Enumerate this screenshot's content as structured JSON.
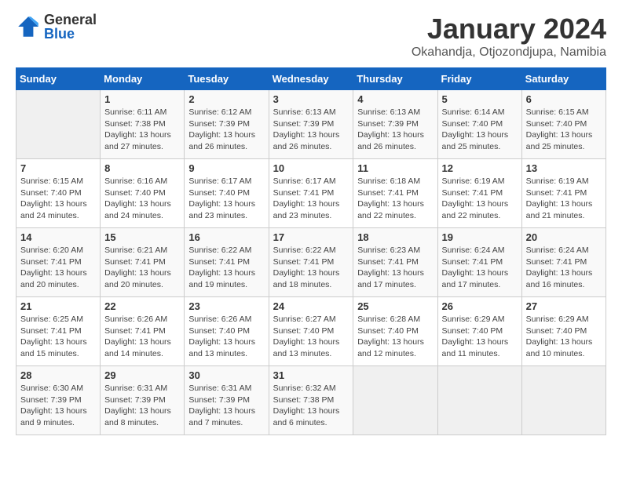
{
  "header": {
    "logo_general": "General",
    "logo_blue": "Blue",
    "month_title": "January 2024",
    "location": "Okahandja, Otjozondjupa, Namibia"
  },
  "days_of_week": [
    "Sunday",
    "Monday",
    "Tuesday",
    "Wednesday",
    "Thursday",
    "Friday",
    "Saturday"
  ],
  "weeks": [
    [
      {
        "day": "",
        "info": ""
      },
      {
        "day": "1",
        "info": "Sunrise: 6:11 AM\nSunset: 7:38 PM\nDaylight: 13 hours and 27 minutes."
      },
      {
        "day": "2",
        "info": "Sunrise: 6:12 AM\nSunset: 7:39 PM\nDaylight: 13 hours and 26 minutes."
      },
      {
        "day": "3",
        "info": "Sunrise: 6:13 AM\nSunset: 7:39 PM\nDaylight: 13 hours and 26 minutes."
      },
      {
        "day": "4",
        "info": "Sunrise: 6:13 AM\nSunset: 7:39 PM\nDaylight: 13 hours and 26 minutes."
      },
      {
        "day": "5",
        "info": "Sunrise: 6:14 AM\nSunset: 7:40 PM\nDaylight: 13 hours and 25 minutes."
      },
      {
        "day": "6",
        "info": "Sunrise: 6:15 AM\nSunset: 7:40 PM\nDaylight: 13 hours and 25 minutes."
      }
    ],
    [
      {
        "day": "7",
        "info": "Sunrise: 6:15 AM\nSunset: 7:40 PM\nDaylight: 13 hours and 24 minutes."
      },
      {
        "day": "8",
        "info": "Sunrise: 6:16 AM\nSunset: 7:40 PM\nDaylight: 13 hours and 24 minutes."
      },
      {
        "day": "9",
        "info": "Sunrise: 6:17 AM\nSunset: 7:40 PM\nDaylight: 13 hours and 23 minutes."
      },
      {
        "day": "10",
        "info": "Sunrise: 6:17 AM\nSunset: 7:41 PM\nDaylight: 13 hours and 23 minutes."
      },
      {
        "day": "11",
        "info": "Sunrise: 6:18 AM\nSunset: 7:41 PM\nDaylight: 13 hours and 22 minutes."
      },
      {
        "day": "12",
        "info": "Sunrise: 6:19 AM\nSunset: 7:41 PM\nDaylight: 13 hours and 22 minutes."
      },
      {
        "day": "13",
        "info": "Sunrise: 6:19 AM\nSunset: 7:41 PM\nDaylight: 13 hours and 21 minutes."
      }
    ],
    [
      {
        "day": "14",
        "info": "Sunrise: 6:20 AM\nSunset: 7:41 PM\nDaylight: 13 hours and 20 minutes."
      },
      {
        "day": "15",
        "info": "Sunrise: 6:21 AM\nSunset: 7:41 PM\nDaylight: 13 hours and 20 minutes."
      },
      {
        "day": "16",
        "info": "Sunrise: 6:22 AM\nSunset: 7:41 PM\nDaylight: 13 hours and 19 minutes."
      },
      {
        "day": "17",
        "info": "Sunrise: 6:22 AM\nSunset: 7:41 PM\nDaylight: 13 hours and 18 minutes."
      },
      {
        "day": "18",
        "info": "Sunrise: 6:23 AM\nSunset: 7:41 PM\nDaylight: 13 hours and 17 minutes."
      },
      {
        "day": "19",
        "info": "Sunrise: 6:24 AM\nSunset: 7:41 PM\nDaylight: 13 hours and 17 minutes."
      },
      {
        "day": "20",
        "info": "Sunrise: 6:24 AM\nSunset: 7:41 PM\nDaylight: 13 hours and 16 minutes."
      }
    ],
    [
      {
        "day": "21",
        "info": "Sunrise: 6:25 AM\nSunset: 7:41 PM\nDaylight: 13 hours and 15 minutes."
      },
      {
        "day": "22",
        "info": "Sunrise: 6:26 AM\nSunset: 7:41 PM\nDaylight: 13 hours and 14 minutes."
      },
      {
        "day": "23",
        "info": "Sunrise: 6:26 AM\nSunset: 7:40 PM\nDaylight: 13 hours and 13 minutes."
      },
      {
        "day": "24",
        "info": "Sunrise: 6:27 AM\nSunset: 7:40 PM\nDaylight: 13 hours and 13 minutes."
      },
      {
        "day": "25",
        "info": "Sunrise: 6:28 AM\nSunset: 7:40 PM\nDaylight: 13 hours and 12 minutes."
      },
      {
        "day": "26",
        "info": "Sunrise: 6:29 AM\nSunset: 7:40 PM\nDaylight: 13 hours and 11 minutes."
      },
      {
        "day": "27",
        "info": "Sunrise: 6:29 AM\nSunset: 7:40 PM\nDaylight: 13 hours and 10 minutes."
      }
    ],
    [
      {
        "day": "28",
        "info": "Sunrise: 6:30 AM\nSunset: 7:39 PM\nDaylight: 13 hours and 9 minutes."
      },
      {
        "day": "29",
        "info": "Sunrise: 6:31 AM\nSunset: 7:39 PM\nDaylight: 13 hours and 8 minutes."
      },
      {
        "day": "30",
        "info": "Sunrise: 6:31 AM\nSunset: 7:39 PM\nDaylight: 13 hours and 7 minutes."
      },
      {
        "day": "31",
        "info": "Sunrise: 6:32 AM\nSunset: 7:38 PM\nDaylight: 13 hours and 6 minutes."
      },
      {
        "day": "",
        "info": ""
      },
      {
        "day": "",
        "info": ""
      },
      {
        "day": "",
        "info": ""
      }
    ]
  ]
}
